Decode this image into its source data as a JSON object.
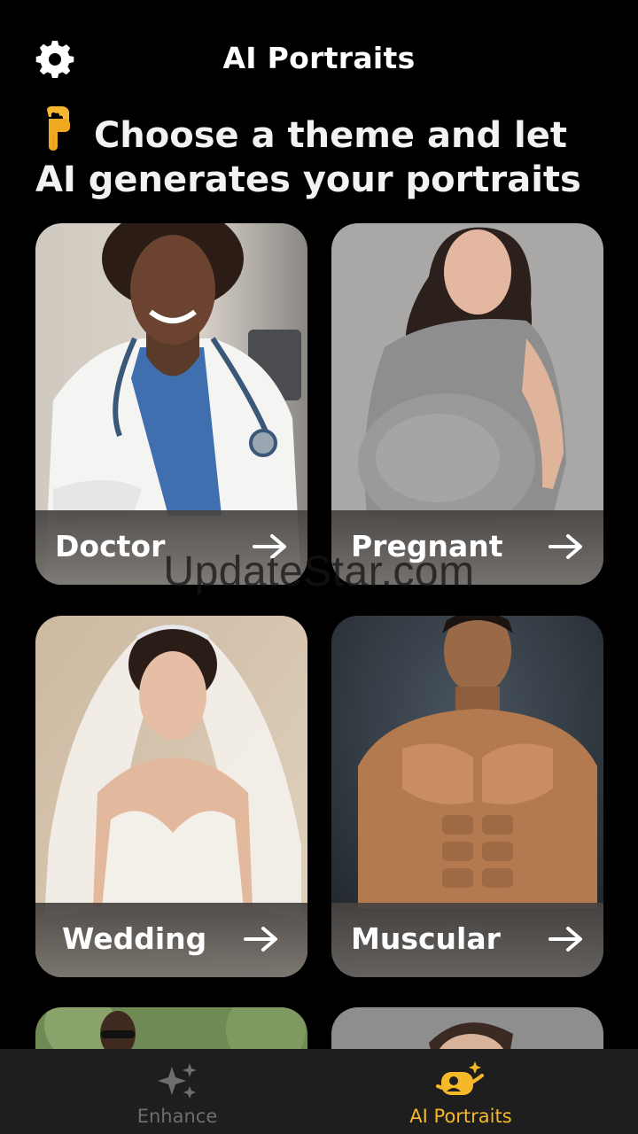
{
  "header": {
    "title": "AI Portraits",
    "settings_icon": "gear-icon"
  },
  "headline": {
    "emoji": "backhand-index-pointing-down-emoji",
    "text": "Choose a theme and let AI generates your portraits"
  },
  "themes": [
    {
      "label": "Doctor",
      "photo": "woman in white doctor coat with stethoscope",
      "icon": "arrow-right-icon"
    },
    {
      "label": "Pregnant",
      "photo": "pregnant woman in grey top",
      "icon": "arrow-right-icon"
    },
    {
      "label": "Wedding",
      "photo": "bride in white dress with veil and tiara",
      "icon": "arrow-right-icon"
    },
    {
      "label": "Muscular",
      "photo": "shirtless muscular man",
      "icon": "arrow-right-icon"
    },
    {
      "label": "",
      "photo": "man with sunglasses outdoors (partially visible)"
    },
    {
      "label": "",
      "photo": "man with slicked hair (partially visible)"
    }
  ],
  "watermark": "UpdateStar.com",
  "tabbar": {
    "tabs": [
      {
        "label": "Enhance",
        "icon": "sparkles-icon",
        "active": false
      },
      {
        "label": "AI Portraits",
        "icon": "portrait-camera-icon",
        "active": true
      }
    ],
    "active_color": "#f4b829",
    "inactive_color": "#6e6e6e"
  }
}
